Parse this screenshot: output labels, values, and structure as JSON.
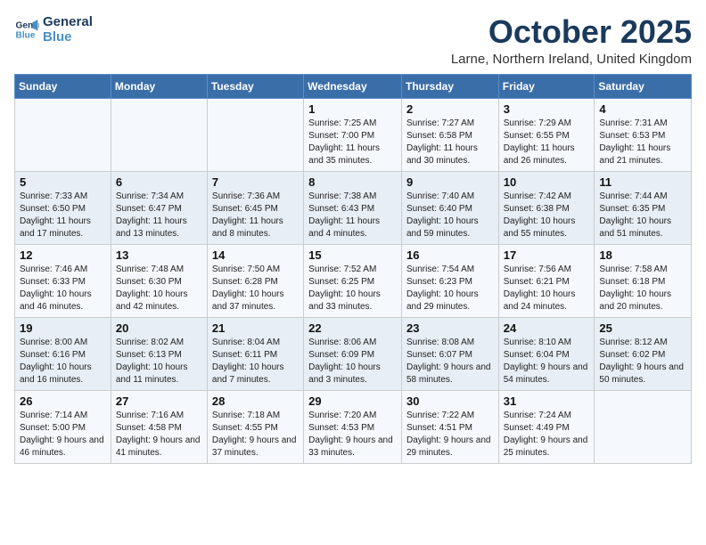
{
  "logo": {
    "line1": "General",
    "line2": "Blue"
  },
  "title": "October 2025",
  "subtitle": "Larne, Northern Ireland, United Kingdom",
  "days_of_week": [
    "Sunday",
    "Monday",
    "Tuesday",
    "Wednesday",
    "Thursday",
    "Friday",
    "Saturday"
  ],
  "weeks": [
    [
      {
        "day": "",
        "info": ""
      },
      {
        "day": "",
        "info": ""
      },
      {
        "day": "",
        "info": ""
      },
      {
        "day": "1",
        "info": "Sunrise: 7:25 AM\nSunset: 7:00 PM\nDaylight: 11 hours and 35 minutes."
      },
      {
        "day": "2",
        "info": "Sunrise: 7:27 AM\nSunset: 6:58 PM\nDaylight: 11 hours and 30 minutes."
      },
      {
        "day": "3",
        "info": "Sunrise: 7:29 AM\nSunset: 6:55 PM\nDaylight: 11 hours and 26 minutes."
      },
      {
        "day": "4",
        "info": "Sunrise: 7:31 AM\nSunset: 6:53 PM\nDaylight: 11 hours and 21 minutes."
      }
    ],
    [
      {
        "day": "5",
        "info": "Sunrise: 7:33 AM\nSunset: 6:50 PM\nDaylight: 11 hours and 17 minutes."
      },
      {
        "day": "6",
        "info": "Sunrise: 7:34 AM\nSunset: 6:47 PM\nDaylight: 11 hours and 13 minutes."
      },
      {
        "day": "7",
        "info": "Sunrise: 7:36 AM\nSunset: 6:45 PM\nDaylight: 11 hours and 8 minutes."
      },
      {
        "day": "8",
        "info": "Sunrise: 7:38 AM\nSunset: 6:43 PM\nDaylight: 11 hours and 4 minutes."
      },
      {
        "day": "9",
        "info": "Sunrise: 7:40 AM\nSunset: 6:40 PM\nDaylight: 10 hours and 59 minutes."
      },
      {
        "day": "10",
        "info": "Sunrise: 7:42 AM\nSunset: 6:38 PM\nDaylight: 10 hours and 55 minutes."
      },
      {
        "day": "11",
        "info": "Sunrise: 7:44 AM\nSunset: 6:35 PM\nDaylight: 10 hours and 51 minutes."
      }
    ],
    [
      {
        "day": "12",
        "info": "Sunrise: 7:46 AM\nSunset: 6:33 PM\nDaylight: 10 hours and 46 minutes."
      },
      {
        "day": "13",
        "info": "Sunrise: 7:48 AM\nSunset: 6:30 PM\nDaylight: 10 hours and 42 minutes."
      },
      {
        "day": "14",
        "info": "Sunrise: 7:50 AM\nSunset: 6:28 PM\nDaylight: 10 hours and 37 minutes."
      },
      {
        "day": "15",
        "info": "Sunrise: 7:52 AM\nSunset: 6:25 PM\nDaylight: 10 hours and 33 minutes."
      },
      {
        "day": "16",
        "info": "Sunrise: 7:54 AM\nSunset: 6:23 PM\nDaylight: 10 hours and 29 minutes."
      },
      {
        "day": "17",
        "info": "Sunrise: 7:56 AM\nSunset: 6:21 PM\nDaylight: 10 hours and 24 minutes."
      },
      {
        "day": "18",
        "info": "Sunrise: 7:58 AM\nSunset: 6:18 PM\nDaylight: 10 hours and 20 minutes."
      }
    ],
    [
      {
        "day": "19",
        "info": "Sunrise: 8:00 AM\nSunset: 6:16 PM\nDaylight: 10 hours and 16 minutes."
      },
      {
        "day": "20",
        "info": "Sunrise: 8:02 AM\nSunset: 6:13 PM\nDaylight: 10 hours and 11 minutes."
      },
      {
        "day": "21",
        "info": "Sunrise: 8:04 AM\nSunset: 6:11 PM\nDaylight: 10 hours and 7 minutes."
      },
      {
        "day": "22",
        "info": "Sunrise: 8:06 AM\nSunset: 6:09 PM\nDaylight: 10 hours and 3 minutes."
      },
      {
        "day": "23",
        "info": "Sunrise: 8:08 AM\nSunset: 6:07 PM\nDaylight: 9 hours and 58 minutes."
      },
      {
        "day": "24",
        "info": "Sunrise: 8:10 AM\nSunset: 6:04 PM\nDaylight: 9 hours and 54 minutes."
      },
      {
        "day": "25",
        "info": "Sunrise: 8:12 AM\nSunset: 6:02 PM\nDaylight: 9 hours and 50 minutes."
      }
    ],
    [
      {
        "day": "26",
        "info": "Sunrise: 7:14 AM\nSunset: 5:00 PM\nDaylight: 9 hours and 46 minutes."
      },
      {
        "day": "27",
        "info": "Sunrise: 7:16 AM\nSunset: 4:58 PM\nDaylight: 9 hours and 41 minutes."
      },
      {
        "day": "28",
        "info": "Sunrise: 7:18 AM\nSunset: 4:55 PM\nDaylight: 9 hours and 37 minutes."
      },
      {
        "day": "29",
        "info": "Sunrise: 7:20 AM\nSunset: 4:53 PM\nDaylight: 9 hours and 33 minutes."
      },
      {
        "day": "30",
        "info": "Sunrise: 7:22 AM\nSunset: 4:51 PM\nDaylight: 9 hours and 29 minutes."
      },
      {
        "day": "31",
        "info": "Sunrise: 7:24 AM\nSunset: 4:49 PM\nDaylight: 9 hours and 25 minutes."
      },
      {
        "day": "",
        "info": ""
      }
    ]
  ]
}
